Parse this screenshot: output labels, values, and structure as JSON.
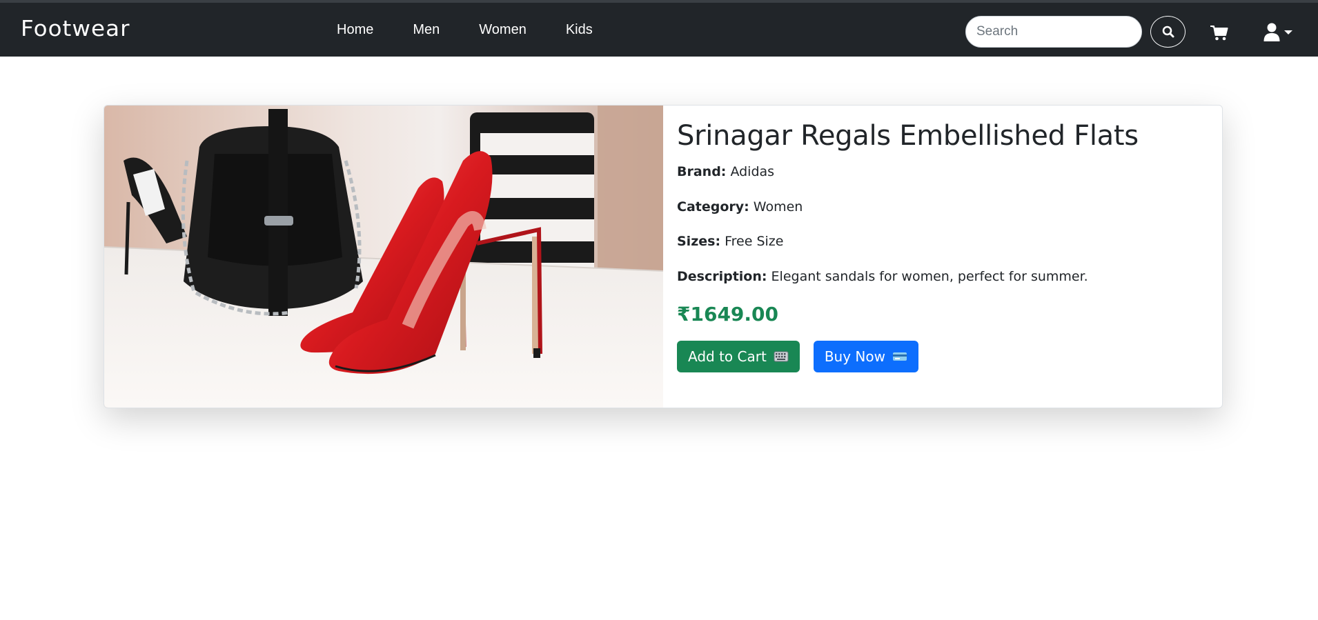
{
  "navbar": {
    "brand": "Footwear",
    "links": [
      "Home",
      "Men",
      "Women",
      "Kids"
    ],
    "search_placeholder": "Search",
    "icons": {
      "search": "search-icon",
      "cart": "cart-icon",
      "user": "user-icon",
      "dropdown": "caret-down-icon"
    },
    "bg_color": "#212529"
  },
  "product": {
    "title": "Srinagar Regals Embellished Flats",
    "brand_label": "Brand:",
    "brand": "Adidas",
    "category_label": "Category:",
    "category": "Women",
    "sizes_label": "Sizes:",
    "sizes": "Free Size",
    "description_label": "Description:",
    "description": "Elegant sandals for women, perfect for summer.",
    "price": "₹1649.00",
    "image": "red-high-heels-with-black-handbag-photo",
    "price_color": "#198754"
  },
  "actions": {
    "add_to_cart": "Add to Cart",
    "add_to_cart_icon": "keyboard-icon",
    "buy_now": "Buy Now",
    "buy_now_icon": "credit-card-icon",
    "add_to_cart_color": "#198754",
    "buy_now_color": "#0d6efd"
  }
}
